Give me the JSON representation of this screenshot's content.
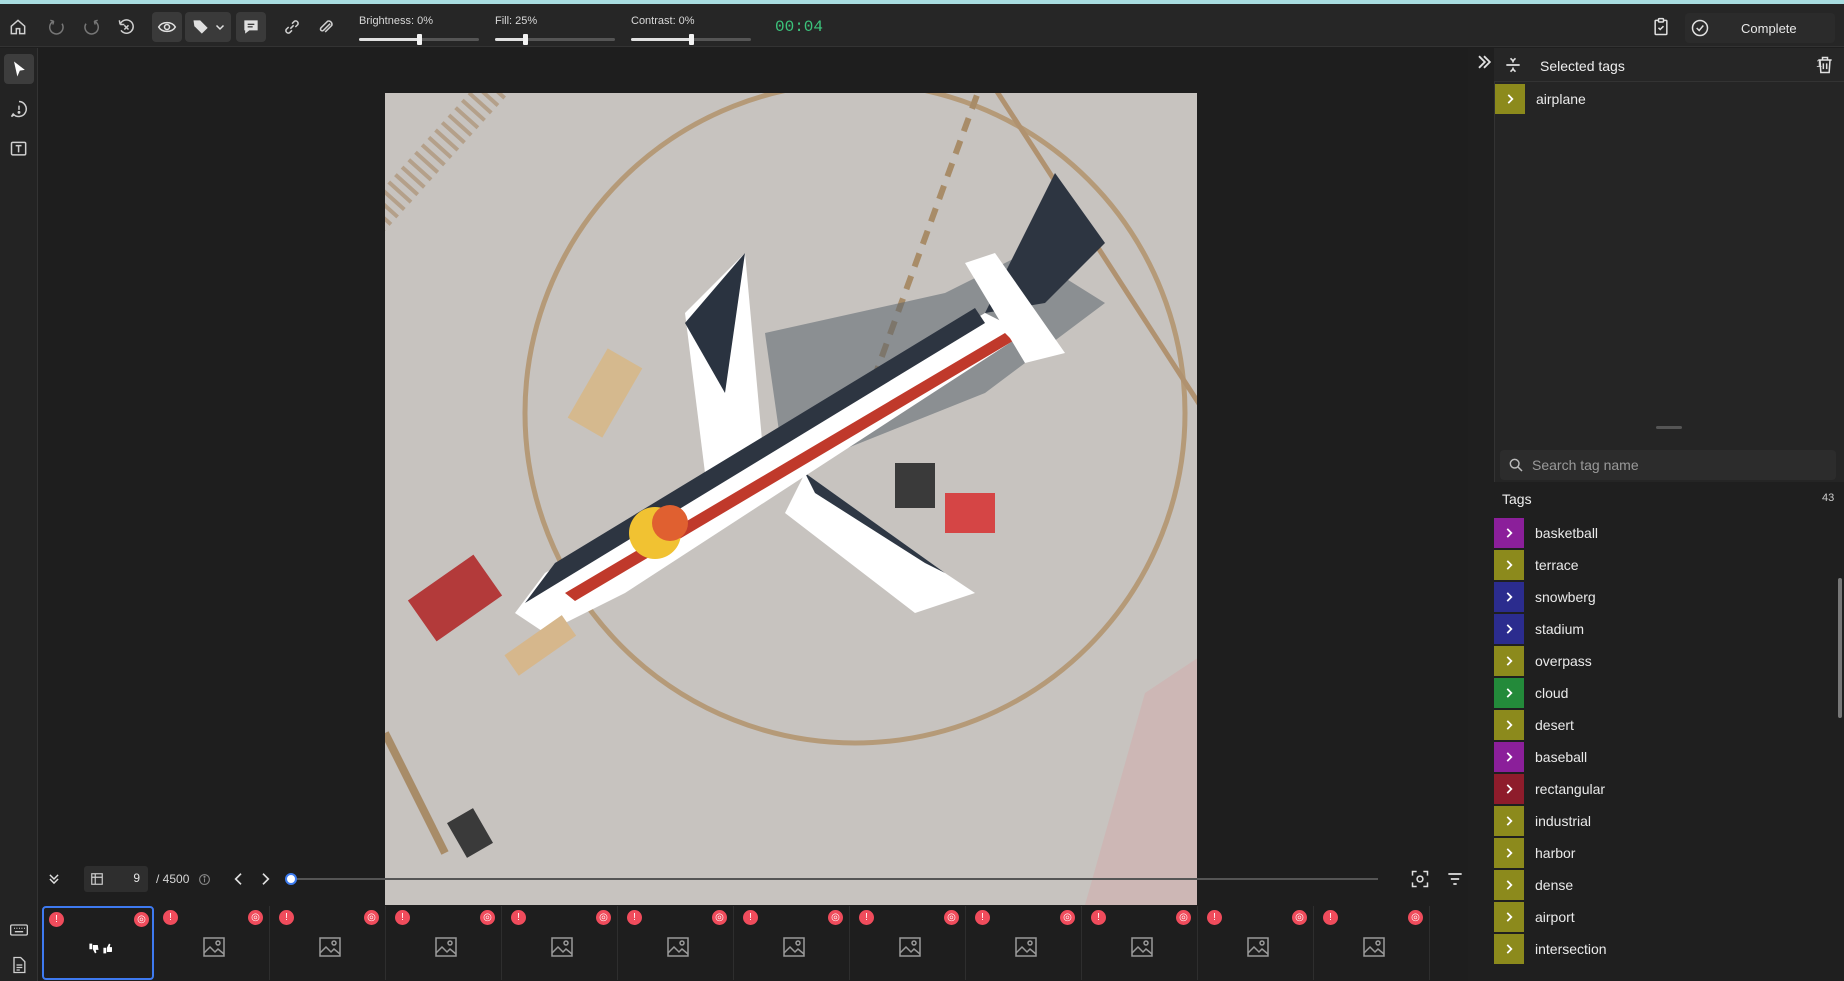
{
  "toolbar": {
    "brightness_label": "Brightness: 0%",
    "brightness_value": 0.5,
    "fill_label": "Fill: 25%",
    "fill_value": 0.25,
    "contrast_label": "Contrast: 0%",
    "contrast_value": 0.5,
    "timer": "00:04",
    "complete_label": "Complete"
  },
  "navigation": {
    "current_frame": "9",
    "total_frames": "/ 4500",
    "progress": 0.002
  },
  "selected_tags": {
    "title": "Selected tags",
    "count": "1",
    "items": [
      {
        "name": "airplane",
        "color": "#8c8a1c"
      }
    ]
  },
  "tag_search": {
    "placeholder": "Search tag name"
  },
  "tags": {
    "title": "Tags",
    "count": "43",
    "items": [
      {
        "name": "basketball",
        "color": "#8b1f9a"
      },
      {
        "name": "terrace",
        "color": "#8c8a1c"
      },
      {
        "name": "snowberg",
        "color": "#2b2c8e"
      },
      {
        "name": "stadium",
        "color": "#2b2c8e"
      },
      {
        "name": "overpass",
        "color": "#8c8a1c"
      },
      {
        "name": "cloud",
        "color": "#238a3a"
      },
      {
        "name": "desert",
        "color": "#8c8a1c"
      },
      {
        "name": "baseball",
        "color": "#8b1f9a"
      },
      {
        "name": "rectangular",
        "color": "#8e1c2b"
      },
      {
        "name": "industrial",
        "color": "#8c8a1c"
      },
      {
        "name": "harbor",
        "color": "#8c8a1c"
      },
      {
        "name": "dense",
        "color": "#8c8a1c"
      },
      {
        "name": "airport",
        "color": "#8c8a1c"
      },
      {
        "name": "intersection",
        "color": "#8c8a1c"
      }
    ]
  },
  "filmstrip_count": 12
}
